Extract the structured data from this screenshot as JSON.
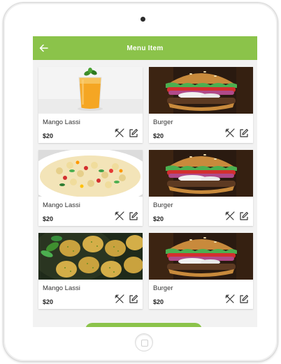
{
  "header": {
    "title": "Menu  Item",
    "back_icon": "arrow-left-icon"
  },
  "theme": {
    "accent": "#8bc34a"
  },
  "items": [
    {
      "name": "Mango Lassi",
      "price": "$20",
      "image": "mango-lassi-glass"
    },
    {
      "name": "Burger",
      "price": "$20",
      "image": "burger"
    },
    {
      "name": "Mango Lassi",
      "price": "$20",
      "image": "pasta-salad"
    },
    {
      "name": "Burger",
      "price": "$20",
      "image": "burger"
    },
    {
      "name": "Mango Lassi",
      "price": "$20",
      "image": "fried-patties"
    },
    {
      "name": "Burger",
      "price": "$20",
      "image": "burger"
    }
  ],
  "actions": {
    "delete_icon": "crossed-utensils-icon",
    "edit_icon": "edit-icon"
  }
}
